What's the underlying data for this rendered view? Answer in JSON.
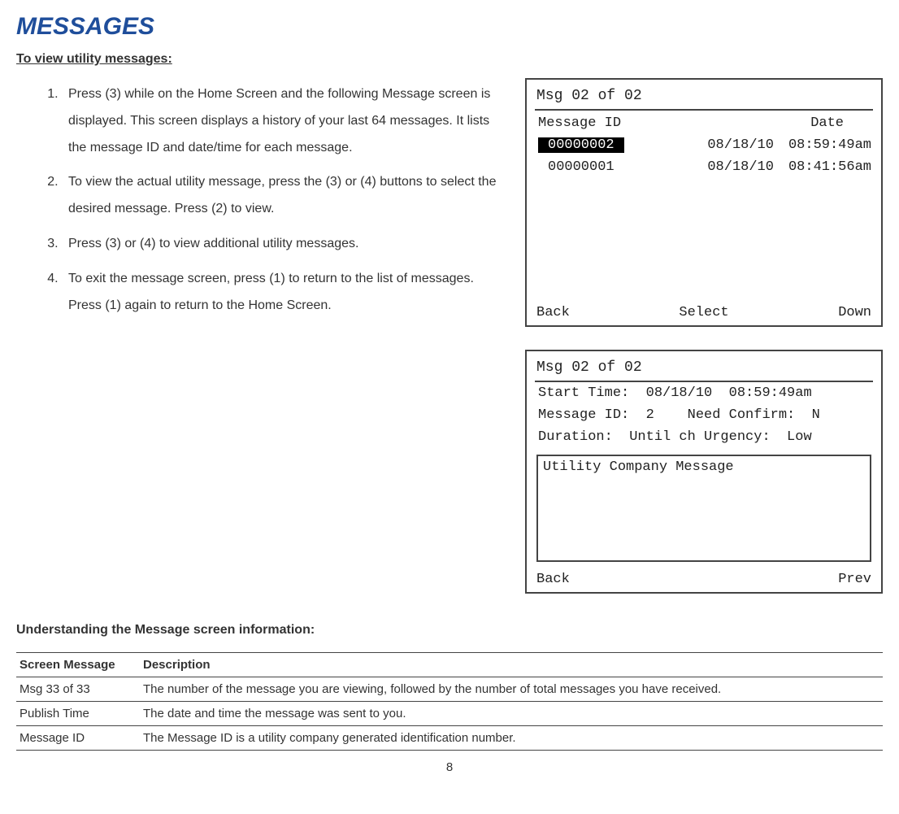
{
  "title": "MESSAGES",
  "subtitle": "To view utility messages:",
  "steps": [
    "Press (3) while on the Home Screen and the following Message screen is displayed.  This screen displays a history of your last 64 messages.  It lists the message ID and date/time for each message.",
    "To view the actual utility message, press the (3) or (4) buttons to select the desired message.  Press (2) to view.",
    "Press (3) or (4) to view additional utility messages.",
    "To exit the message screen, press (1) to return to the list of messages.  Press (1) again to return to the Home Screen."
  ],
  "screen1": {
    "header": "Msg 02 of 02",
    "col_id": "Message ID",
    "col_date": "Date",
    "rows": [
      {
        "id": "00000002",
        "date": "08/18/10",
        "time": "08:59:49am",
        "selected": true
      },
      {
        "id": "00000001",
        "date": "08/18/10",
        "time": "08:41:56am",
        "selected": false
      }
    ],
    "soft_left": "Back",
    "soft_center": "Select",
    "soft_right": "Down"
  },
  "screen2": {
    "header": "Msg 02 of 02",
    "line1": "Start Time:  08/18/10  08:59:49am",
    "line2": "Message ID:  2    Need Confirm:  N",
    "line3": "Duration:  Until ch Urgency:  Low",
    "msg": "Utility Company Message",
    "soft_left": "Back",
    "soft_right": "Prev"
  },
  "subtitle2": "Understanding the Message screen information:",
  "table": {
    "head": {
      "col1": "Screen Message",
      "col2": "Description"
    },
    "rows": [
      {
        "col1": "Msg 33 of 33",
        "col2": "The number of the message you are viewing, followed by the number of total messages you have received."
      },
      {
        "col1": "Publish Time",
        "col2": "The date and time the message was sent to you."
      },
      {
        "col1": "Message ID",
        "col2": "The Message ID is a utility company generated identification number."
      }
    ]
  },
  "page_number": "8"
}
